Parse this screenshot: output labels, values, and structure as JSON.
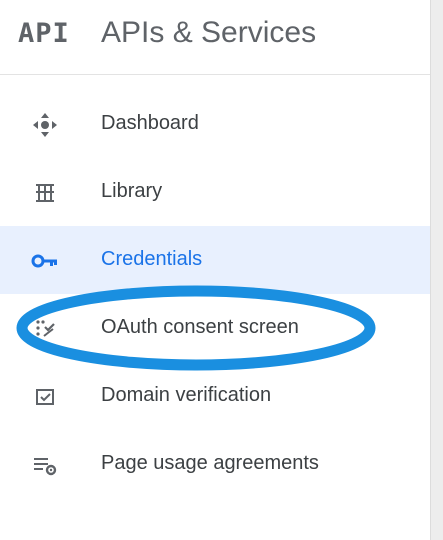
{
  "header": {
    "logo_text": "API",
    "title": "APIs & Services"
  },
  "nav": {
    "items": [
      {
        "label": "Dashboard",
        "icon": "dashboard-icon",
        "active": false
      },
      {
        "label": "Library",
        "icon": "library-icon",
        "active": false
      },
      {
        "label": "Credentials",
        "icon": "key-icon",
        "active": true
      },
      {
        "label": "OAuth consent screen",
        "icon": "oauth-consent-icon",
        "active": false
      },
      {
        "label": "Domain verification",
        "icon": "checkbox-icon",
        "active": false
      },
      {
        "label": "Page usage agreements",
        "icon": "list-settings-icon",
        "active": false
      }
    ]
  },
  "colors": {
    "active_background": "#e8f0fe",
    "active_text": "#1a73e8",
    "annotation_stroke": "#1a8fe0",
    "icon_gray": "#5f6368"
  }
}
